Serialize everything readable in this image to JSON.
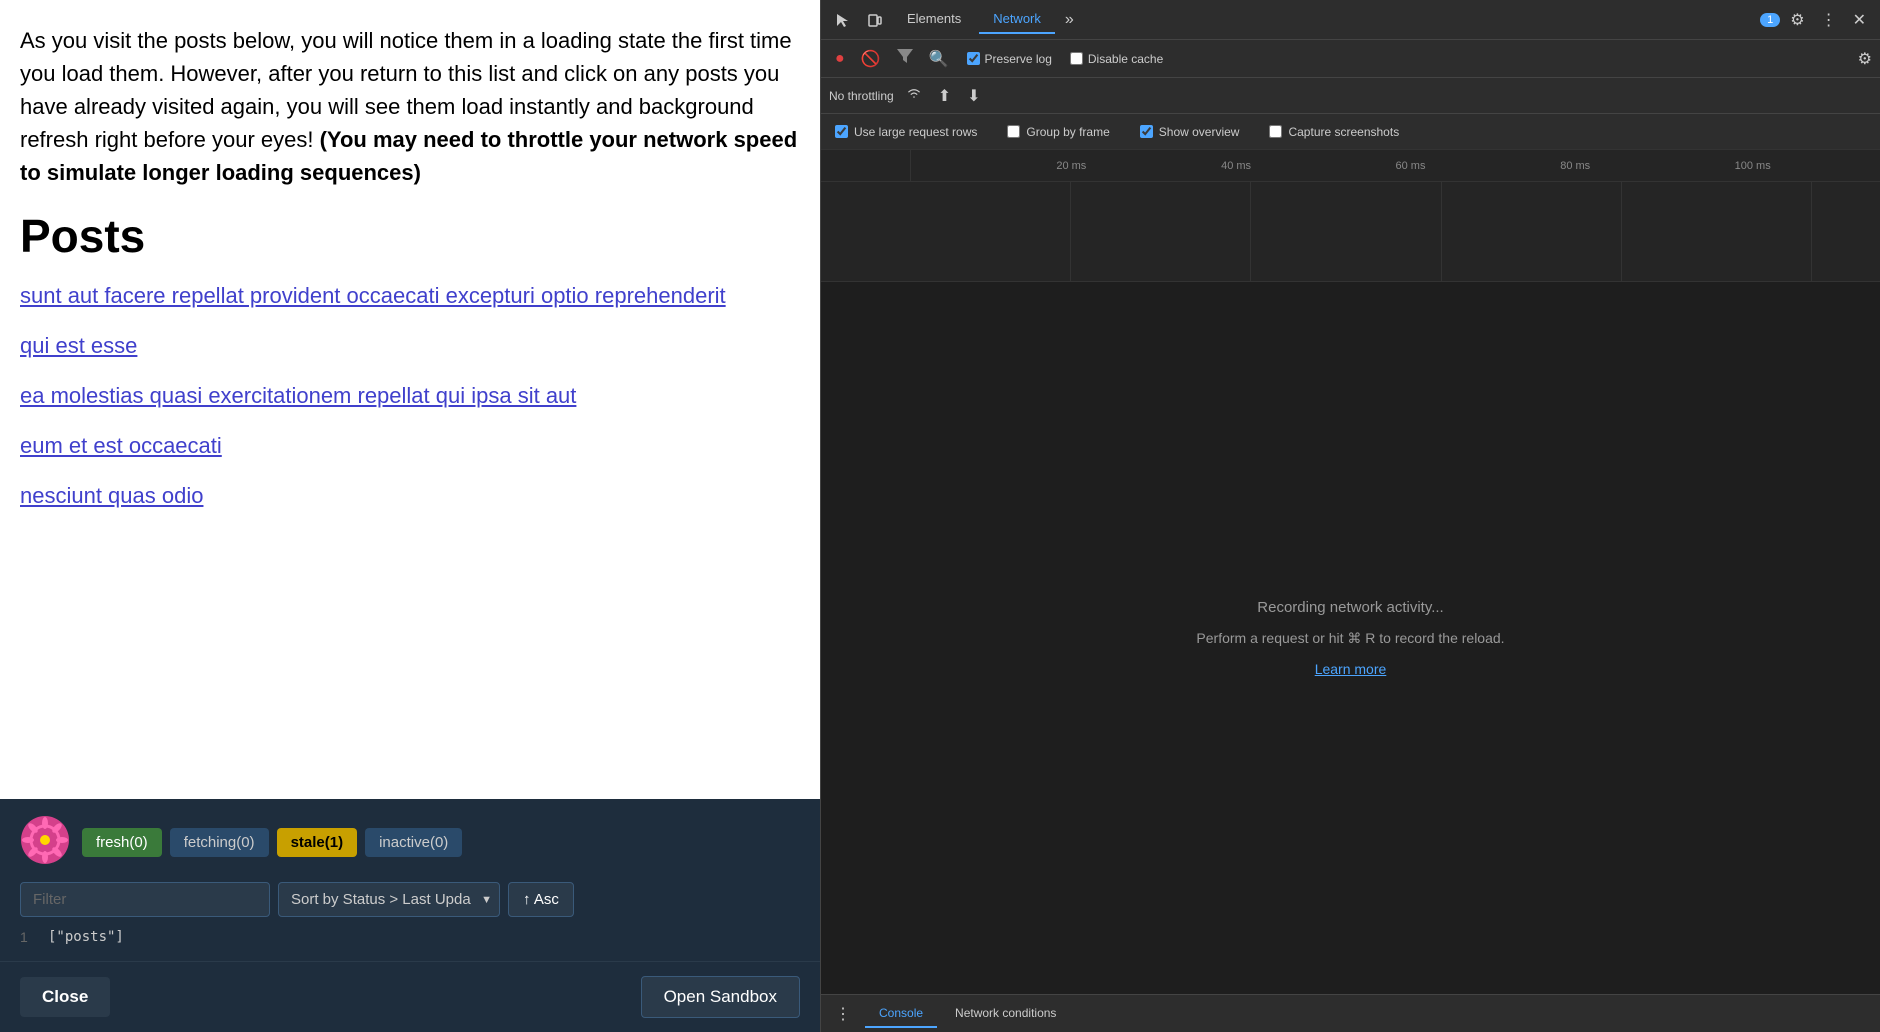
{
  "left": {
    "intro_text": "As you visit the posts below, you will notice them in a loading state the first time you load them. However, after you return to this list and click on any posts you have already visited again, you will see them load instantly and background refresh right before your eyes!",
    "intro_bold": "(You may need to throttle your network speed to simulate longer loading sequences)",
    "posts_heading": "Posts",
    "post_links": [
      "sunt aut facere repellat provident occaecati excepturi optio reprehenderit",
      "qui est esse",
      "ea molestias quasi exercitationem repellat qui ipsa sit aut",
      "eum et est occaecati",
      "nesciunt quas odio"
    ],
    "status_buttons": {
      "fresh": "fresh(0)",
      "fetching": "fetching(0)",
      "stale": "stale(1)",
      "inactive": "inactive(0)"
    },
    "filter_placeholder": "Filter",
    "sort_label": "Sort by Status > Last Upda",
    "asc_label": "↑ Asc",
    "query_number": "1",
    "query_value": "[\"posts\"]",
    "close_label": "Close",
    "sandbox_label": "Open Sandbox"
  },
  "devtools": {
    "tabs": {
      "elements": "Elements",
      "network": "Network"
    },
    "more_tabs": "»",
    "counter": "1",
    "toolbar": {
      "preserve_log": "Preserve log",
      "disable_cache": "Disable cache",
      "no_throttling": "No throttling"
    },
    "options": {
      "use_large_rows": "Use large request rows",
      "show_overview": "Show overview",
      "group_by_frame": "Group by frame",
      "capture_screenshots": "Capture screenshots"
    },
    "timeline": {
      "ticks": [
        "20 ms",
        "40 ms",
        "60 ms",
        "80 ms",
        "100 ms"
      ]
    },
    "empty_state": {
      "line1": "Recording network activity...",
      "line2": "Perform a request or hit ⌘ R to record the reload.",
      "learn_more": "Learn more"
    },
    "bottom_tabs": {
      "console": "Console",
      "network_conditions": "Network conditions"
    }
  }
}
